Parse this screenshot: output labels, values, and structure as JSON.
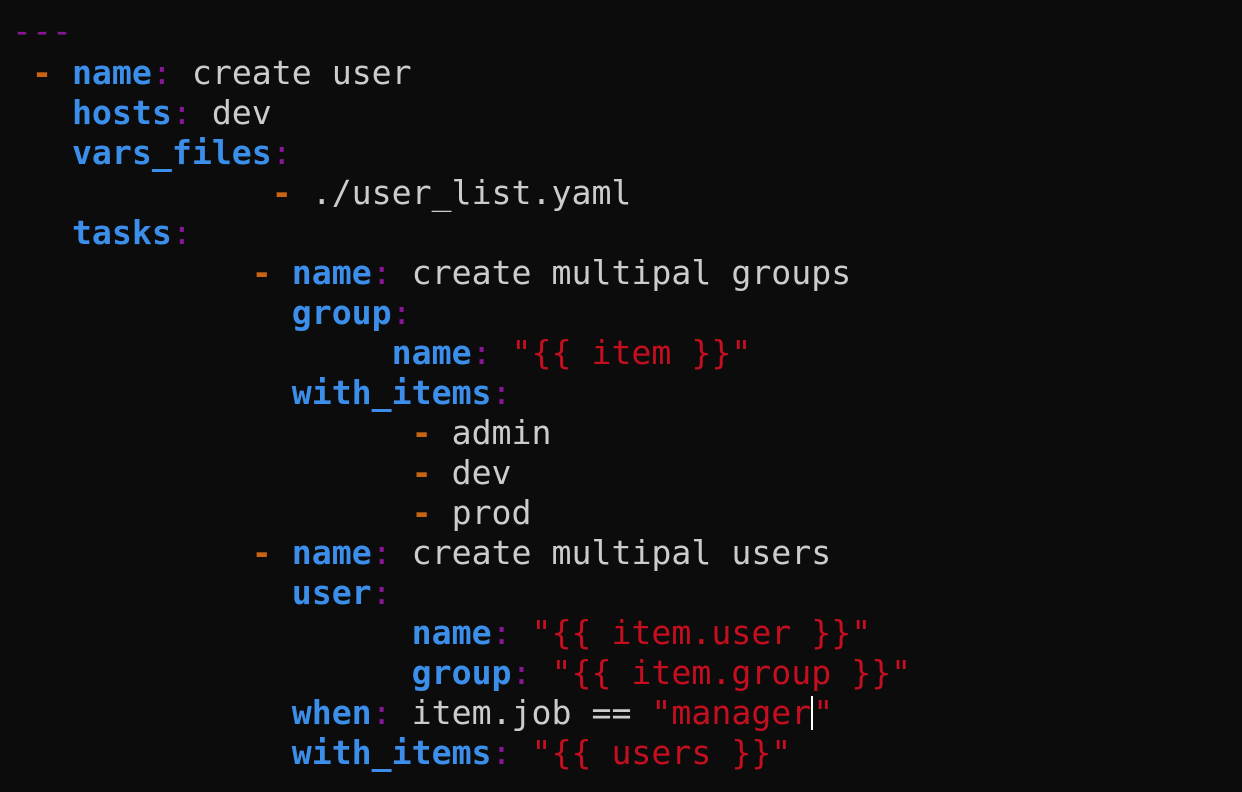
{
  "editor": {
    "doc_start": "---",
    "filler_tilde": "~",
    "colors": {
      "background": "#0c0c0c",
      "key": "#3b8eea",
      "colon": "#881798",
      "dash": "#c86414",
      "string": "#c50f1f",
      "text": "#cccccc"
    },
    "lines": [
      {
        "key": "name",
        "value": "create user"
      },
      {
        "key": "hosts",
        "value": "dev"
      },
      {
        "key": "vars_files"
      },
      {
        "value": "./user_list.yaml"
      },
      {
        "key": "tasks"
      },
      {
        "key": "name",
        "value": "create multipal groups"
      },
      {
        "key": "group"
      },
      {
        "key": "name",
        "value": "\"{{ item }}\""
      },
      {
        "key": "with_items"
      },
      {
        "value": "admin"
      },
      {
        "value": "dev"
      },
      {
        "value": "prod"
      },
      {
        "key": "name",
        "value": "create multipal users"
      },
      {
        "key": "user"
      },
      {
        "key": "name",
        "value": "\"{{ item.user }}\""
      },
      {
        "key": "group",
        "value": "\"{{ item.group }}\""
      },
      {
        "key": "when",
        "value_plain": "item.job == ",
        "value_str_before_cursor": "\"manager",
        "value_str_after_cursor": "\""
      },
      {
        "key": "with_items",
        "value": "\"{{ users }}\""
      }
    ]
  }
}
